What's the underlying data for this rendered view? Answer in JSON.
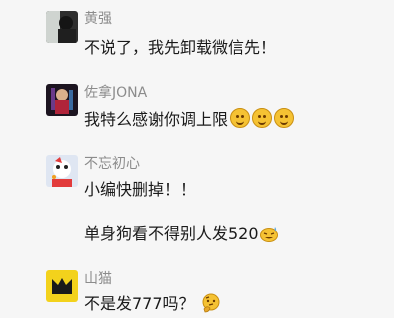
{
  "comments": [
    {
      "name": "黄强",
      "lines": [
        "不说了，我先卸载微信先！"
      ]
    },
    {
      "name": "佐拿JONA",
      "lines": [
        "我特么感谢你调上限"
      ]
    },
    {
      "name": "不忘初心",
      "lines": [
        "小编快删掉！！",
        "单身狗看不得别人发520"
      ]
    },
    {
      "name": "山猫",
      "lines": [
        "不是发777吗？"
      ]
    }
  ],
  "icons": {
    "smile": "slightly-smiling-face-icon",
    "sweat": "grinning-sweat-face-icon",
    "thinking": "thinking-face-icon"
  },
  "colors": {
    "background": "#f6f6f6",
    "name": "#8c8c8c",
    "text": "#1a1a1a",
    "emoji": "#f5c233"
  }
}
